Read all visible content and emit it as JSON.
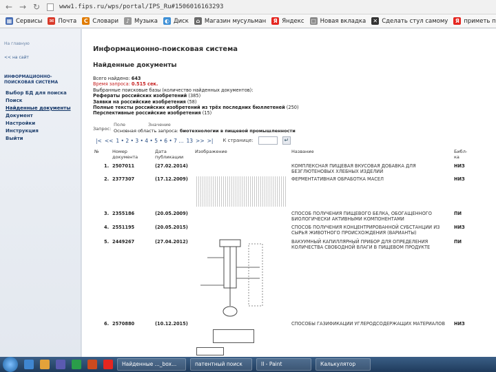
{
  "browser": {
    "address": "www1.fips.ru/wps/portal/IPS_Ru#1506016163293"
  },
  "bookmarks": [
    {
      "label": "Сервисы",
      "icon": "apps-icon",
      "color": "#4a6fb5"
    },
    {
      "label": "Почта",
      "icon": "mail-icon",
      "color": "#d93b2b"
    },
    {
      "label": "Словари",
      "icon": "dictionary-icon",
      "color": "#e07b00"
    },
    {
      "label": "Музыка",
      "icon": "music-icon",
      "color": "#999999"
    },
    {
      "label": "Диск",
      "icon": "disk-icon",
      "color": "#3d8fd6"
    },
    {
      "label": "Магазин мусульман",
      "icon": "shop-icon",
      "color": "#6a6a6a"
    },
    {
      "label": "Яндекс",
      "icon": "yandex-icon",
      "color": "#e52620"
    },
    {
      "label": "Новая вкладка",
      "icon": "page-icon",
      "color": "#8a8a8a"
    },
    {
      "label": "Сделать стул самому",
      "icon": "chair-icon",
      "color": "#333333"
    },
    {
      "label": "приметь по прав",
      "icon": "yandex-icon",
      "color": "#e52620"
    }
  ],
  "left_panel": {
    "top_link": "На главную",
    "back_link": "<< на сайт",
    "system_name_1": "ИНФОРМАЦИОННО-",
    "system_name_2": "ПОИСКОВАЯ СИСТЕМА",
    "menu": [
      {
        "label": "Выбор БД для поиска",
        "active": false
      },
      {
        "label": "Поиск",
        "active": false
      },
      {
        "label": "Найденные документы",
        "active": true
      },
      {
        "label": "Документ",
        "active": false
      },
      {
        "label": "Настройки",
        "active": false
      },
      {
        "label": "Инструкция",
        "active": false
      },
      {
        "label": "Выйти",
        "active": false
      }
    ]
  },
  "content": {
    "system_title": "Информационно-поисковая система",
    "found_title": "Найденные документы",
    "total_label": "Всего найдено:",
    "total_value": "643",
    "time_label": "Время запроса:",
    "time_value": "0.515 сек.",
    "databases_label": "Выбранные поисковые базы (количество найденных документов):",
    "databases": [
      {
        "name": "Рефераты российских изобретений",
        "count": "(385)"
      },
      {
        "name": "Заявки на российские изобретения",
        "count": "(58)"
      },
      {
        "name": "Полные тексты российских изобретений из трёх последних бюллетеней",
        "count": "(250)"
      },
      {
        "name": "Перспективные российские изобретения",
        "count": "(15)"
      }
    ],
    "query_label": "Запрос:",
    "query_field_header": "Поле",
    "query_value_header": "Значение",
    "query_field": "Основная область запроса:",
    "query_value": "биотехнологии в пищевой промышленности",
    "pager_first": "|<",
    "pager_prev": "<<",
    "pager_pages": "1 • 2 • 3 • 4 • 5 • 6 • 7 ...",
    "pager_next": ">>",
    "pager_last": "13",
    "pager_last_sym": ">|",
    "goto_label": "К странице:",
    "go_symbol": "↵"
  },
  "table": {
    "headers": {
      "no": "№",
      "doc_no_1": "Номер",
      "doc_no_2": "документа",
      "date_1": "Дата",
      "date_2": "публикации",
      "image": "Изображение",
      "name": "Название",
      "bib_1": "Библ-",
      "bib_2": "ка"
    },
    "rows": [
      {
        "no": "1.",
        "doc": "2507011",
        "date": "(27.02.2014)",
        "name": "КОМПЛЕКСНАЯ ПИЩЕВАЯ ВКУСОВАЯ ДОБАВКА ДЛЯ БЕЗГЛЮТЕНОВЫХ ХЛЕБНЫХ ИЗДЕЛИЙ",
        "bib": "НИЗ"
      },
      {
        "no": "2.",
        "doc": "2377307",
        "date": "(17.12.2009)",
        "name": "ФЕРМЕНТАТИВНАЯ ОБРАБОТКА МАСЕЛ",
        "bib": "НИЗ"
      },
      {
        "no": "3.",
        "doc": "2355186",
        "date": "(20.05.2009)",
        "name": "СПОСОБ ПОЛУЧЕНИЯ ПИЩЕВОГО БЕЛКА, ОБОГАЩЕННОГО БИОЛОГИЧЕСКИ АКТИВНЫМИ КОМПОНЕНТАМИ",
        "bib": "ПИ"
      },
      {
        "no": "4.",
        "doc": "2551195",
        "date": "(20.05.2015)",
        "name": "СПОСОБ ПОЛУЧЕНИЯ КОНЦЕНТРИРОВАННОЙ СУБСТАНЦИИ ИЗ СЫРЬЯ ЖИВОТНОГО ПРОИСХОЖДЕНИЯ (ВАРИАНТЫ)",
        "bib": "НИЗ"
      },
      {
        "no": "5.",
        "doc": "2449267",
        "date": "(27.04.2012)",
        "name": "ВАКУУМНЫЙ КАПИЛЛЯРНЫЙ ПРИБОР ДЛЯ ОПРЕДЕЛЕНИЯ КОЛИЧЕСТВА СВОБОДНОЙ ВЛАГИ В ПИЩЕВОМ ПРОДУКТЕ",
        "bib": "ПИ"
      },
      {
        "no": "6.",
        "doc": "2570880",
        "date": "(10.12.2015)",
        "name": "СПОСОБЫ ГАЗИФИКАЦИИ УГЛЕРОДСОДЕРЖАЩИХ МАТЕРИАЛОВ",
        "bib": "НИЗ"
      }
    ]
  },
  "taskbar": {
    "tasks": [
      "Найденные ..._box...",
      "патентный поиск",
      "II - Paint",
      "Калькулятор"
    ]
  }
}
